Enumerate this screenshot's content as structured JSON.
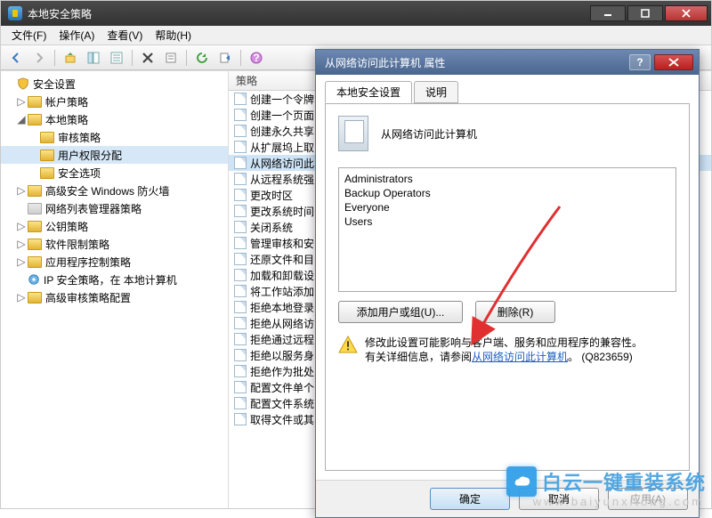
{
  "window": {
    "title": "本地安全策略"
  },
  "menu": {
    "file": "文件(F)",
    "action": "操作(A)",
    "view": "查看(V)",
    "help": "帮助(H)"
  },
  "tree": {
    "root": "安全设置",
    "account": "帐户策略",
    "local": "本地策略",
    "audit": "审核策略",
    "user_rights": "用户权限分配",
    "sec_options": "安全选项",
    "firewall": "高级安全 Windows 防火墙",
    "netlist": "网络列表管理器策略",
    "pubkey": "公钥策略",
    "software_restrict": "软件限制策略",
    "appctrl": "应用程序控制策略",
    "ipsec": "IP 安全策略，在 本地计算机",
    "advanced_audit": "高级审核策略配置"
  },
  "policies": {
    "header": "策略",
    "items": [
      "创建一个令牌",
      "创建一个页面",
      "创建永久共享",
      "从扩展坞上取",
      "从网络访问此",
      "从远程系统强",
      "更改时区",
      "更改系统时间",
      "关闭系统",
      "管理审核和安",
      "还原文件和目",
      "加载和卸载设",
      "将工作站添加",
      "拒绝本地登录",
      "拒绝从网络访",
      "拒绝通过远程",
      "拒绝以服务身",
      "拒绝作为批处",
      "配置文件单个",
      "配置文件系统",
      "取得文件或其"
    ],
    "selected_index": 4
  },
  "dialog": {
    "title": "从网络访问此计算机 属性",
    "tab_local": "本地安全设置",
    "tab_explain": "说明",
    "policy_name": "从网络访问此计算机",
    "users": [
      "Administrators",
      "Backup Operators",
      "Everyone",
      "Users"
    ],
    "add_btn": "添加用户或组(U)...",
    "remove_btn": "删除(R)",
    "warning_line1": "修改此设置可能影响与客户端、服务和应用程序的兼容性。",
    "warning_prefix": "有关详细信息，请参阅",
    "warning_link": "从网络访问此计算机",
    "warning_suffix": "。 (Q823659)",
    "ok": "确定",
    "cancel": "取消",
    "apply": "应用(A)"
  },
  "watermark": {
    "brand": "白云一键重装系统",
    "url": "www.baiyunxitong.com"
  }
}
